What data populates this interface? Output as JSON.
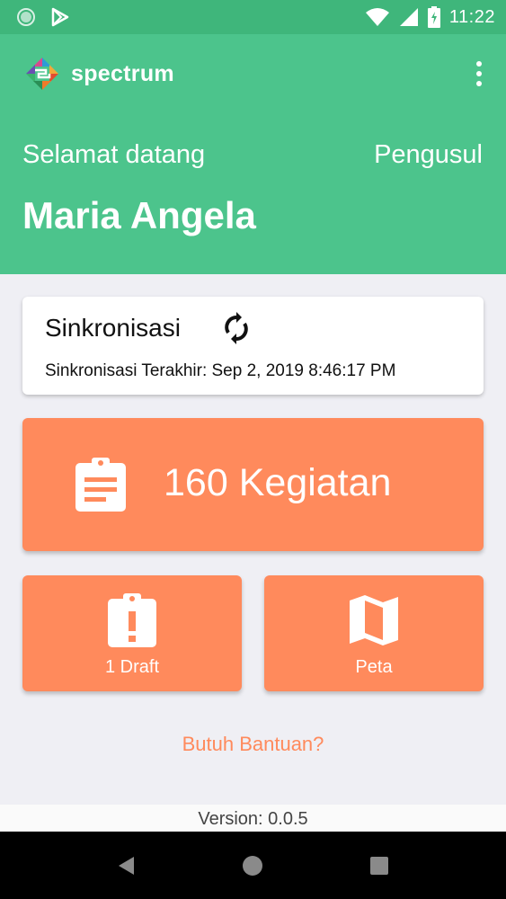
{
  "status_bar": {
    "time": "11:22",
    "icons": [
      "circle-notification-icon",
      "play-store-icon",
      "wifi-icon",
      "signal-icon",
      "battery-charging-icon"
    ]
  },
  "app": {
    "name": "spectrum",
    "logo_icon": "spectrum-logo-icon",
    "menu_icon": "overflow-menu-icon"
  },
  "header": {
    "welcome": "Selamat datang",
    "role": "Pengusul",
    "user_name": "Maria Angela"
  },
  "sync": {
    "title": "Sinkronisasi",
    "icon": "sync-icon",
    "last_sync": "Sinkronisasi Terakhir: Sep 2, 2019 8:46:17 PM"
  },
  "tiles": {
    "activities": {
      "label": "160 Kegiatan",
      "icon": "clipboard-list-icon"
    },
    "draft": {
      "label": "1 Draft",
      "icon": "clipboard-alert-icon"
    },
    "map": {
      "label": "Peta",
      "icon": "map-icon"
    }
  },
  "help": {
    "label": "Butuh Bantuan?"
  },
  "footer": {
    "version": "Version: 0.0.5"
  },
  "navigation": {
    "icons": [
      "back-icon",
      "home-icon",
      "recents-icon"
    ]
  },
  "colors": {
    "status_bar": "#3fb67b",
    "header": "#4cc48c",
    "accent": "#ff8a5c",
    "background": "#efeff4"
  }
}
